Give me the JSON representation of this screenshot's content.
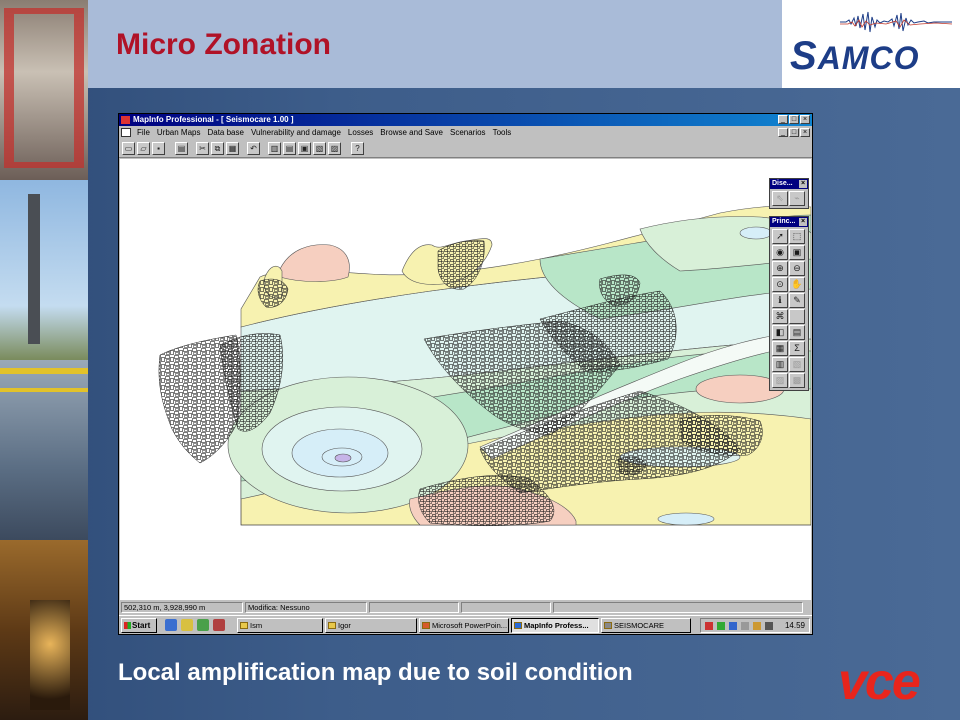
{
  "slide": {
    "title": "Micro Zonation",
    "caption": "Local amplification map due to soil condition",
    "logo_samco": {
      "big_letter": "S",
      "rest": "AMCO"
    },
    "logo_vce": "vce",
    "colors": {
      "title": "#b01227",
      "logo_blue": "#1d3d87",
      "vce_red": "#e8251c"
    }
  },
  "app": {
    "window_title": "MapInfo Professional - [ Seismocare 1.00 ]",
    "window_buttons": [
      "_",
      "□",
      "×"
    ],
    "menu": [
      "File",
      "Urban Maps",
      "Data base",
      "Vulnerability and damage",
      "Losses",
      "Browse and Save",
      "Scenarios",
      "Tools"
    ],
    "toolbar_icons": [
      "new-icon",
      "open-icon",
      "save-icon",
      "print-icon",
      "cut-icon",
      "copy-icon",
      "paste-icon",
      "undo-icon",
      "layer-control-icon",
      "browser-icon",
      "map-icon",
      "graph-icon",
      "layout-icon",
      "help-icon"
    ],
    "palettes": [
      {
        "title": "Dise...",
        "buttons": [
          "⇖",
          "⌁"
        ]
      },
      {
        "title": "Princ...",
        "buttons": [
          "➚",
          "⬚",
          "◉",
          "▣",
          "⊕",
          "⊖",
          "⊙",
          "✋",
          "ℹ",
          "✎",
          "⌘",
          "",
          "◧",
          "▤",
          "▦",
          "Σ",
          "▥",
          "▧",
          "▨",
          "▩"
        ]
      }
    ],
    "status": {
      "coords": "502,310 m, 3,928,990 m",
      "edit": "Modifica: Nessuno"
    },
    "taskbar": {
      "start": "Start",
      "items": [
        "Ism",
        "Igor",
        "Microsoft PowerPoin...",
        "MapInfo Profess...",
        "SEISMOCARE"
      ],
      "active_index": 3,
      "clock": "14.59"
    }
  },
  "map": {
    "zone_colors": {
      "yellow": "#f7f2b0",
      "light_green": "#d8f0d8",
      "green": "#b8e6c8",
      "pale_cyan": "#e0f4f0",
      "light_blue": "#d6eef8",
      "peach": "#f6cfc0",
      "white_zone": "#f4faf6"
    }
  }
}
